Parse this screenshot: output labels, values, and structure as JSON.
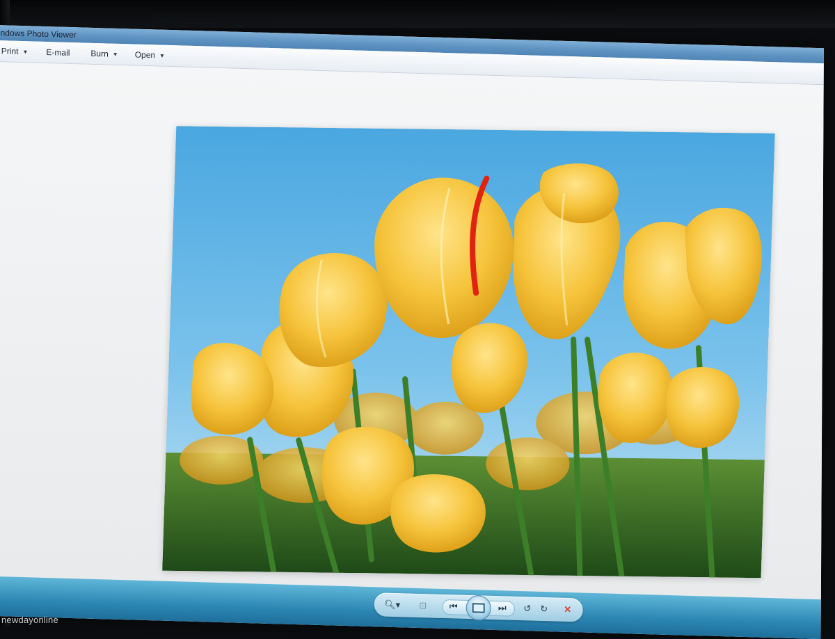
{
  "window": {
    "title": "indows Photo Viewer"
  },
  "menubar": {
    "items": [
      {
        "label": "Print",
        "has_dropdown": true
      },
      {
        "label": "E-mail",
        "has_dropdown": false
      },
      {
        "label": "Burn",
        "has_dropdown": true
      },
      {
        "label": "Open",
        "has_dropdown": true
      }
    ]
  },
  "toolbar": {
    "controls": [
      {
        "icon": "zoom-icon"
      },
      {
        "icon": "actual-size-icon"
      },
      {
        "icon": "previous-icon"
      },
      {
        "icon": "slideshow-icon"
      },
      {
        "icon": "next-icon"
      },
      {
        "icon": "rotate-counterclockwise-icon"
      },
      {
        "icon": "rotate-clockwise-icon"
      },
      {
        "icon": "delete-icon"
      }
    ]
  },
  "photo": {
    "subject": "yellow-tulips-against-blue-sky-icon"
  },
  "watermark": {
    "text": "newdayonline"
  },
  "colors": {
    "sky": "#5fb1e0",
    "tulip": "#f4c23c",
    "stem": "#3f7f2b",
    "toolbar": "#2c87b3",
    "delete": "#d83a2b"
  }
}
